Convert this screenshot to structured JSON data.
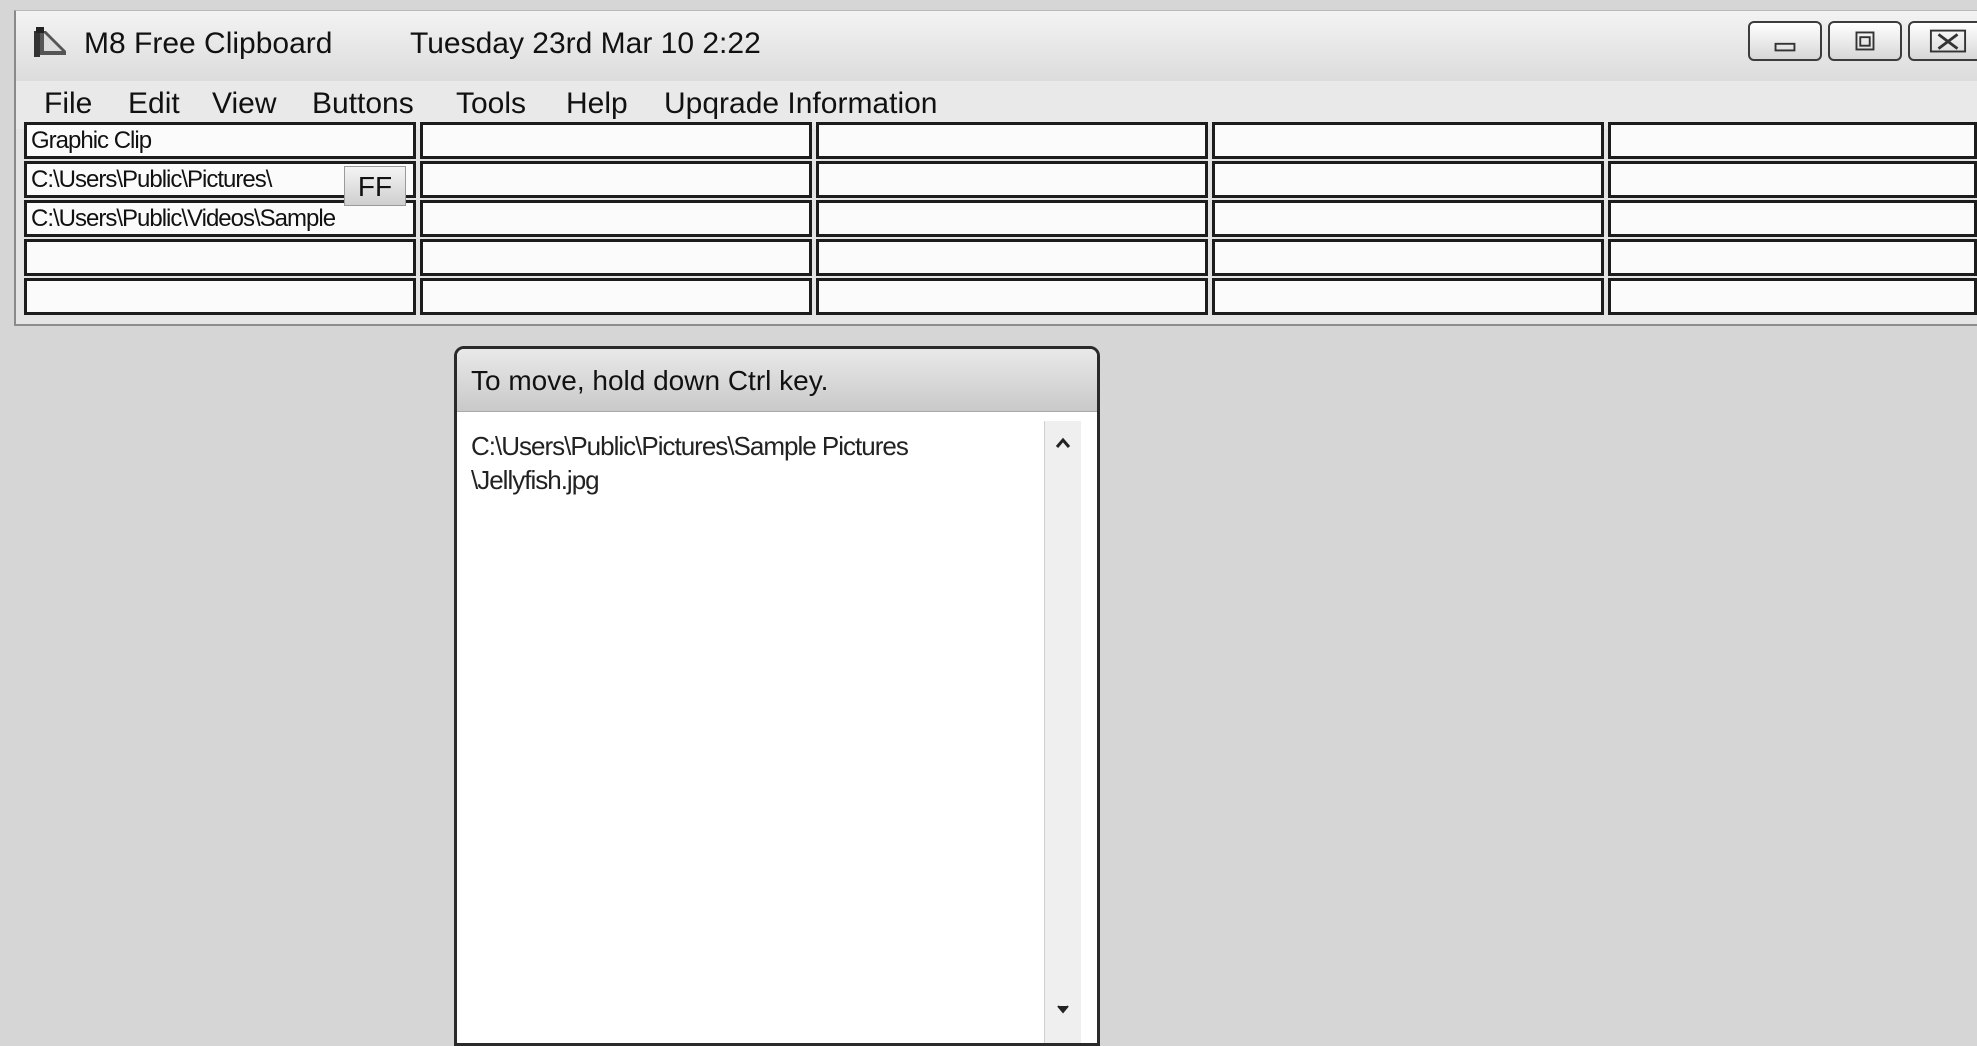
{
  "window": {
    "title": "M8 Free Clipboard",
    "datetime": "Tuesday  23rd Mar 10   2:22"
  },
  "icons": {
    "app": "clipboard-app-icon",
    "minimize": "minimize-icon",
    "maximize": "maximize-icon",
    "close": "close-icon",
    "scroll_up": "chevron-up-icon",
    "scroll_down": "chevron-down-icon"
  },
  "menu": {
    "items": [
      "File",
      "Edit",
      "View",
      "Buttons",
      "Tools",
      "Help",
      "Upqrade Information"
    ]
  },
  "clips": {
    "column1": [
      "Graphic Clip",
      "C:\\Users\\Public\\Pictures\\",
      "C:\\Users\\Public\\Videos\\Sample",
      "",
      ""
    ],
    "ff_button": "FF"
  },
  "popup": {
    "title": "To move, hold down Ctrl key.",
    "content": "C:\\Users\\Public\\Pictures\\Sample Pictures\n\\Jellyfish.jpg"
  }
}
